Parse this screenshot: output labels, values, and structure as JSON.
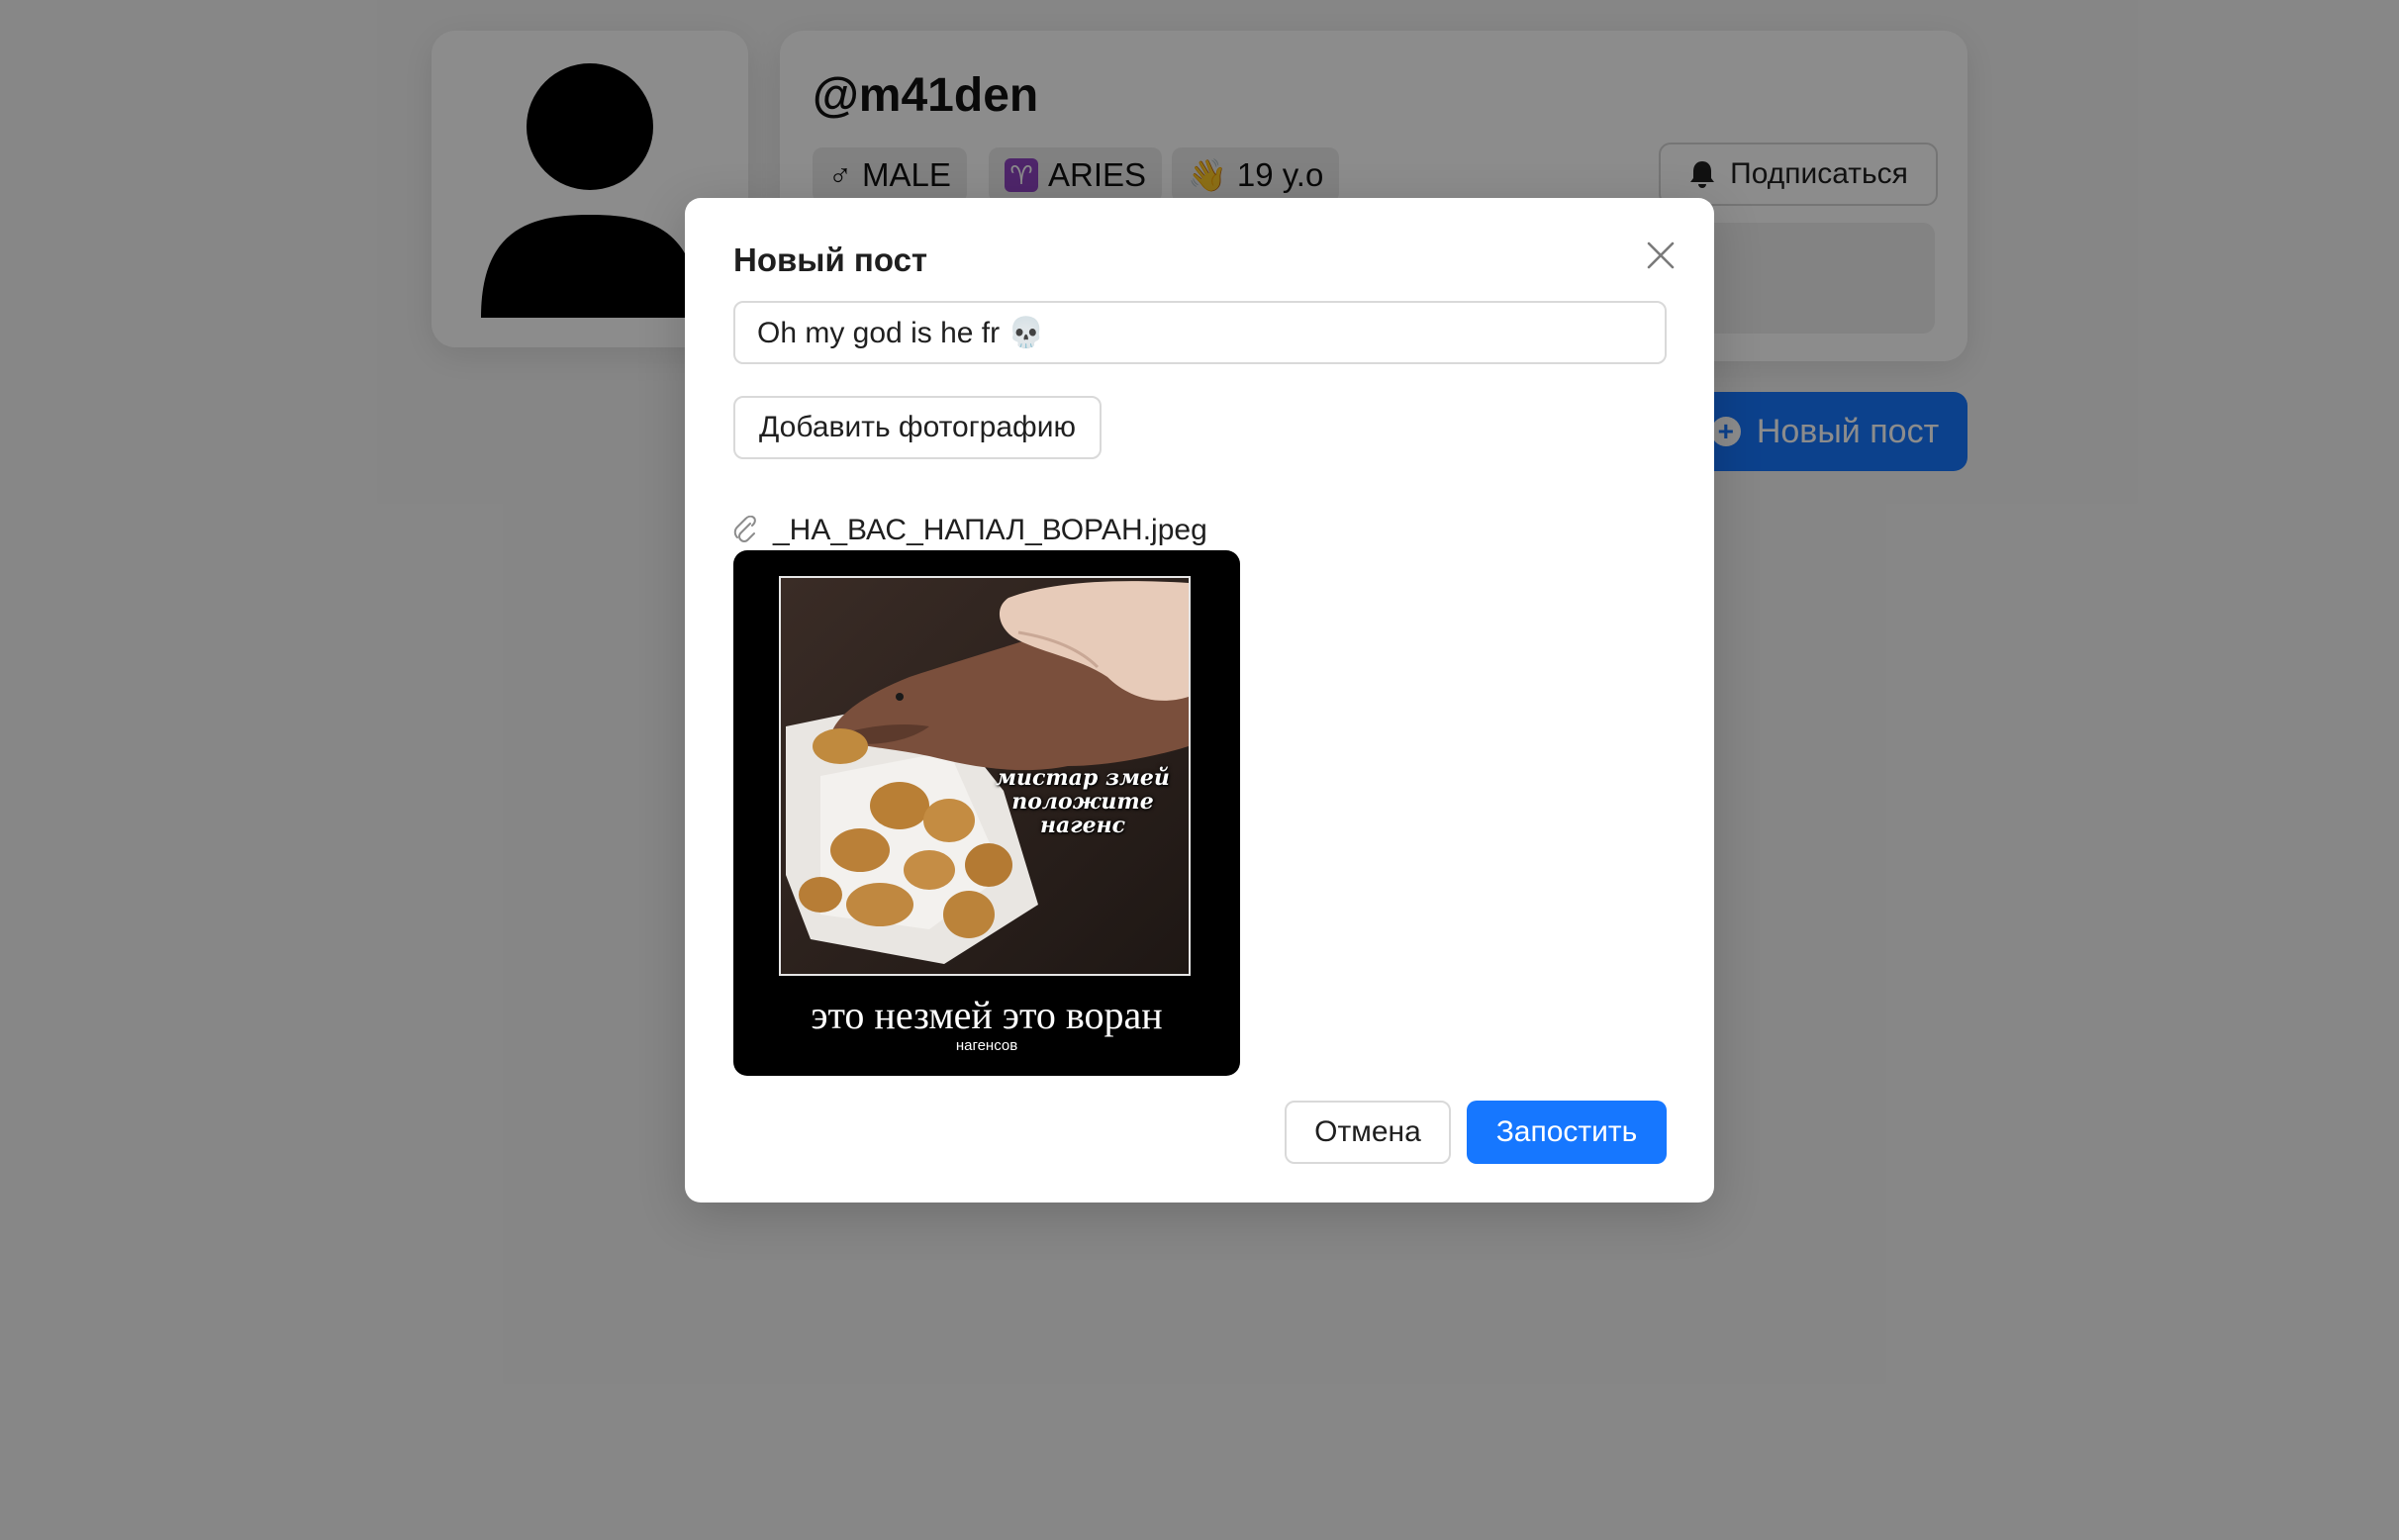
{
  "profile": {
    "username": "@m41den",
    "tags": [
      {
        "icon": "male-sign-icon",
        "glyph": "♂",
        "label": "MALE"
      },
      {
        "icon": "aries-icon",
        "glyph": "♈",
        "label": "ARIES"
      },
      {
        "icon": "waving-hand-icon",
        "glyph": "👋",
        "label": "19 y.o"
      }
    ],
    "subscribe_label": "Подписаться",
    "new_post_label": "Новый пост"
  },
  "modal": {
    "title": "Новый пост",
    "text_value": "Oh my god is he fr 💀",
    "add_photo_label": "Добавить фотографию",
    "attachment_name": "_НА_ВАС_НАПАЛ_ВОРАН.jpeg",
    "image": {
      "overlay_caption": "мистар змей положите нагенс",
      "title": "это незмей это воран",
      "subtitle": "нагенсов"
    },
    "cancel_label": "Отмена",
    "submit_label": "Запостить"
  },
  "colors": {
    "primary": "#1677ff",
    "mask": "rgba(0,0,0,0.45)",
    "aries_badge": "#8e44c2"
  }
}
